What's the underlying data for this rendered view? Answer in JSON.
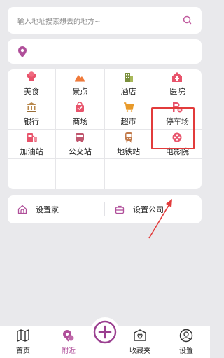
{
  "search": {
    "placeholder": "输入地址搜索想去的地方~",
    "icon": "search-icon"
  },
  "location": {
    "icon": "location-pin-icon",
    "value": ""
  },
  "categories": [
    {
      "label": "美食",
      "icon": "chef-hat-icon",
      "color": "#e8536b"
    },
    {
      "label": "景点",
      "icon": "scenic-spot-icon",
      "color": "#f07a3a"
    },
    {
      "label": "酒店",
      "icon": "hotel-building-icon",
      "color": "#8ea04a"
    },
    {
      "label": "医院",
      "icon": "hospital-icon",
      "color": "#e8536b"
    },
    {
      "label": "银行",
      "icon": "bank-icon",
      "color": "#b8874a"
    },
    {
      "label": "商场",
      "icon": "shopping-bag-icon",
      "color": "#e8536b"
    },
    {
      "label": "超市",
      "icon": "shopping-cart-icon",
      "color": "#e89a2a"
    },
    {
      "label": "停车场",
      "icon": "parking-icon",
      "color": "#e8536b"
    },
    {
      "label": "加油站",
      "icon": "gas-station-icon",
      "color": "#e8536b"
    },
    {
      "label": "公交站",
      "icon": "bus-icon",
      "color": "#c0566e"
    },
    {
      "label": "地铁站",
      "icon": "subway-icon",
      "color": "#c27a4a"
    },
    {
      "label": "电影院",
      "icon": "cinema-icon",
      "color": "#e8536b"
    }
  ],
  "settings": {
    "home_label": "设置家",
    "company_label": "设置公司"
  },
  "tabbar": {
    "items": [
      {
        "label": "首页",
        "icon": "map-icon"
      },
      {
        "label": "附近",
        "icon": "nearby-icon"
      },
      {
        "label": "收藏夹",
        "icon": "favorites-icon"
      },
      {
        "label": "设置",
        "icon": "user-settings-icon"
      }
    ],
    "active": "附近",
    "add_icon": "add-icon"
  },
  "colors": {
    "accent": "#b04f9a",
    "highlight": "#e23b3b",
    "background": "#e9e9ec"
  }
}
